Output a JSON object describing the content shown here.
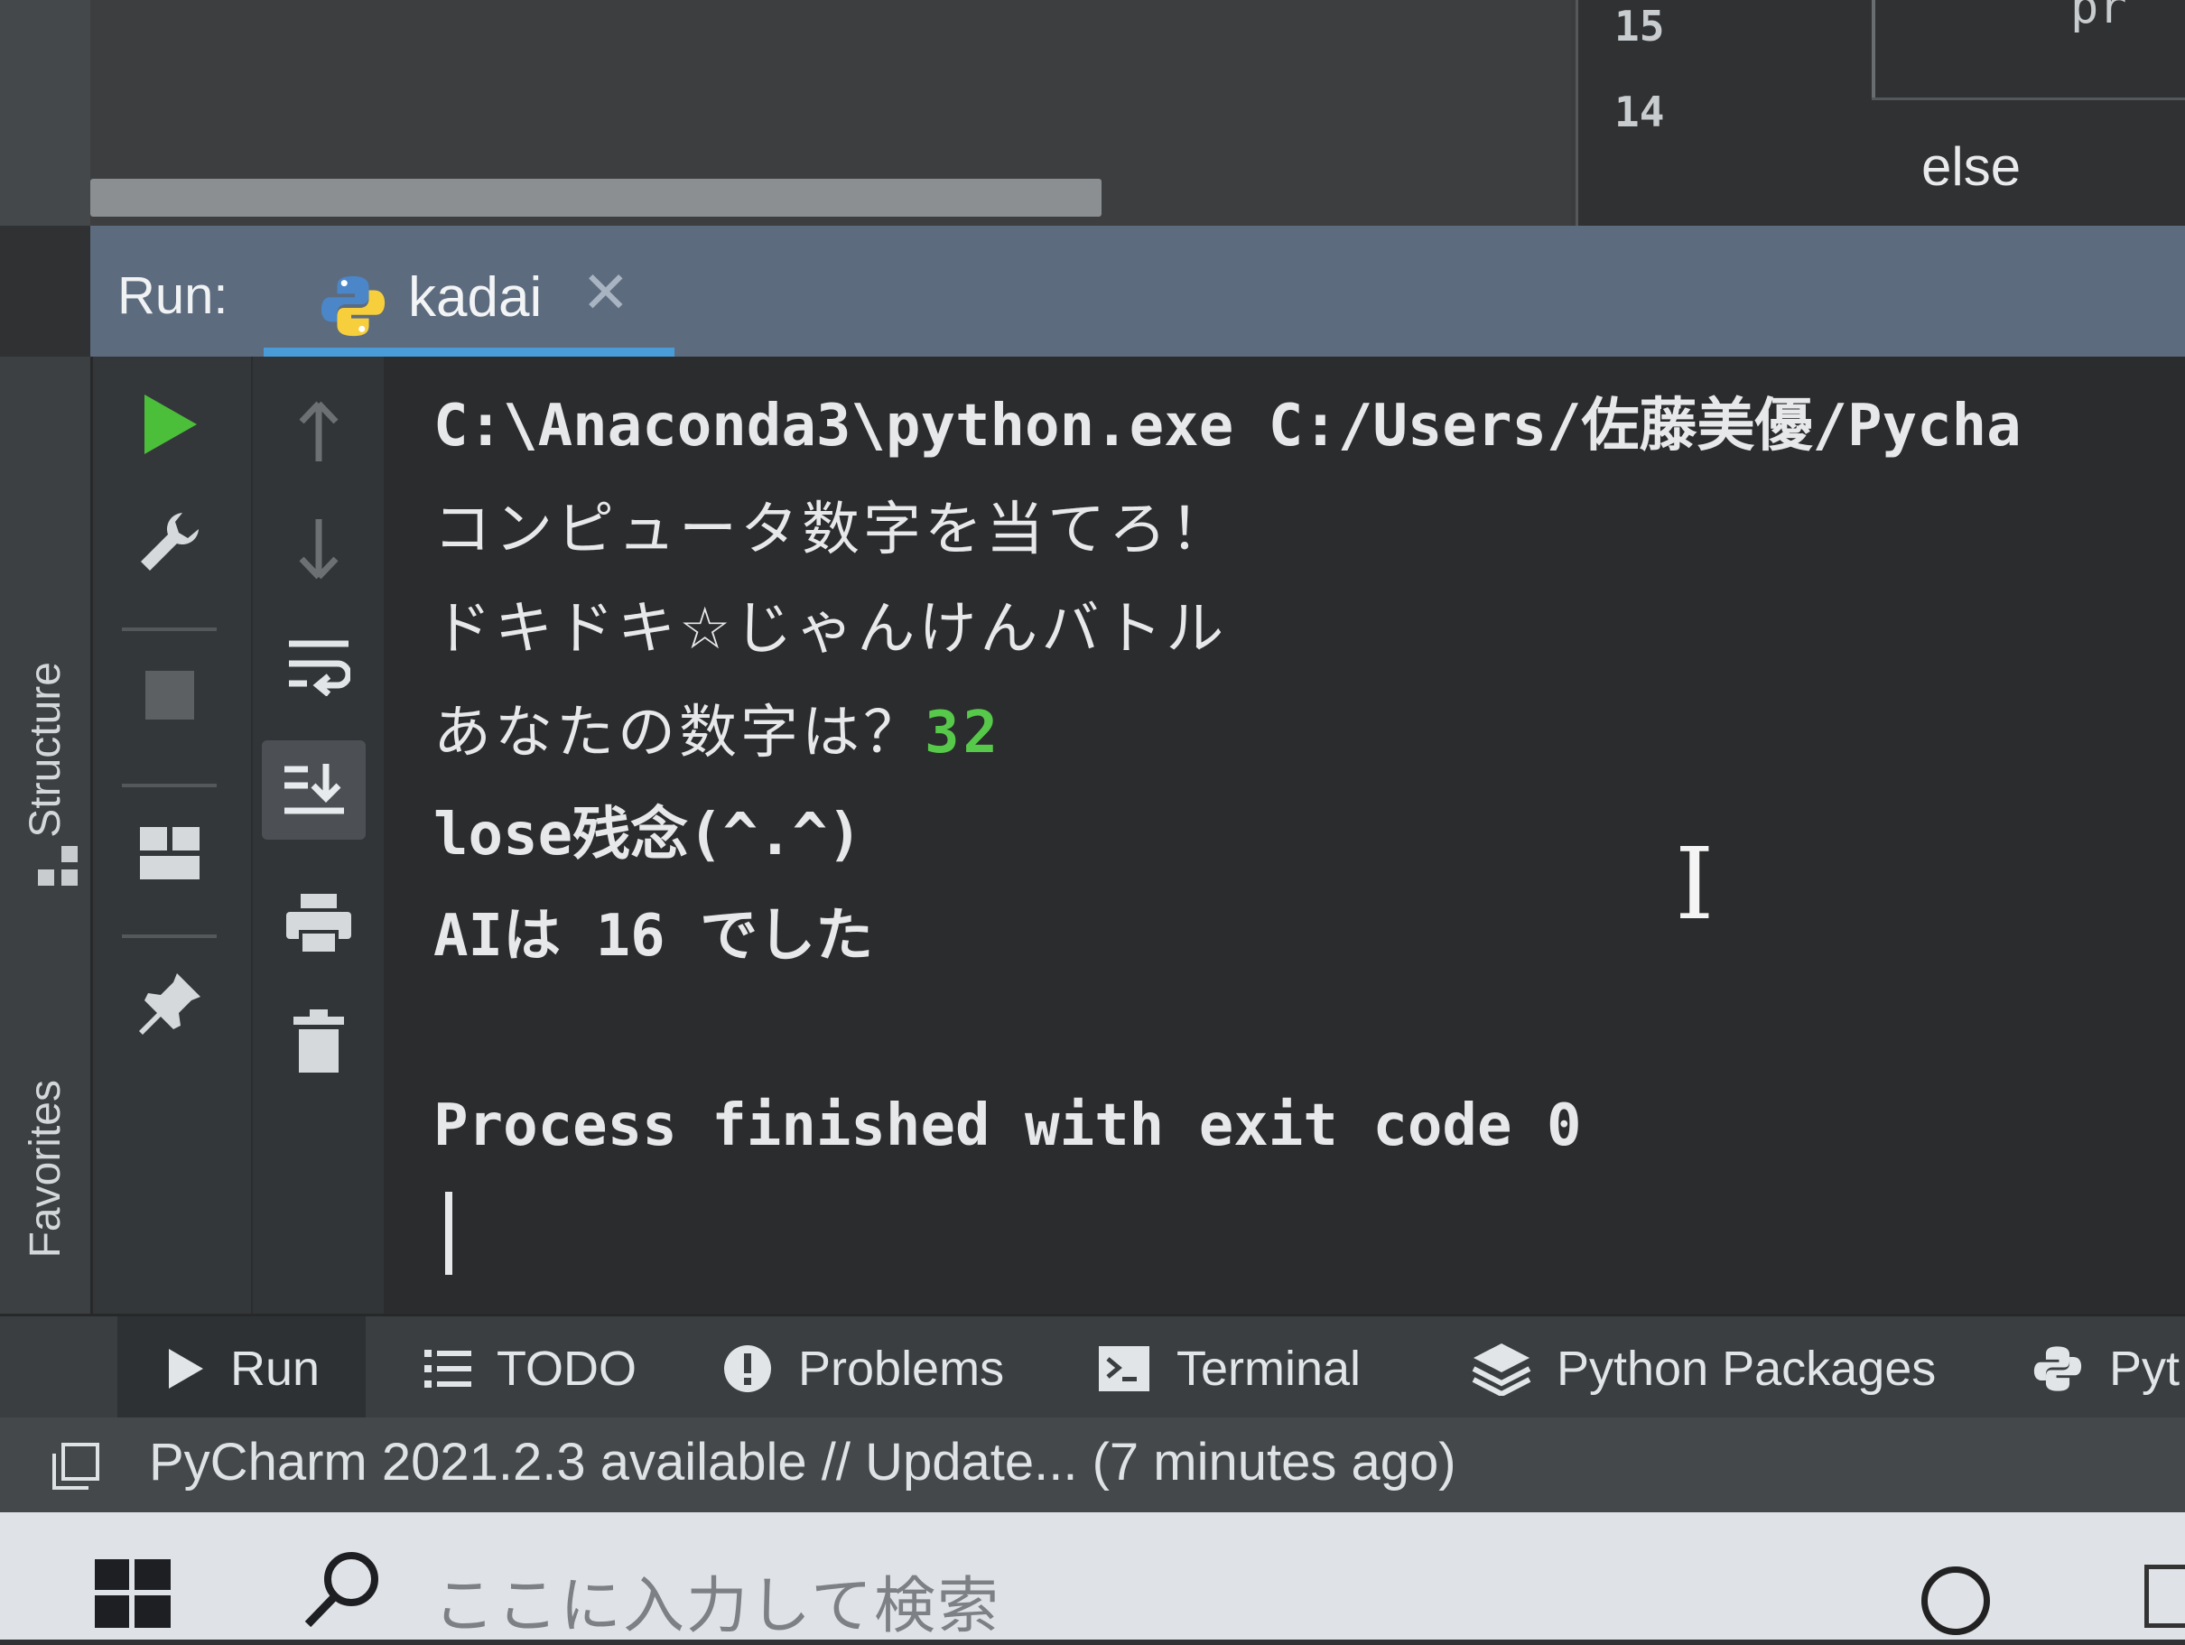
{
  "editor": {
    "line_numbers": [
      "15",
      "14"
    ],
    "right_keyword": "pr",
    "else_keyword": "else"
  },
  "run_panel": {
    "label": "Run:",
    "tab": {
      "name": "kadai",
      "close_glyph": "✕"
    }
  },
  "side_tabs": [
    "Structure",
    "Favorites"
  ],
  "toolbar_left": [
    "run-again",
    "settings-wrench",
    "stop",
    "layout",
    "pin"
  ],
  "toolbar_right": [
    "up-arrow",
    "down-arrow",
    "soft-wrap",
    "scroll-to-end",
    "print",
    "trash"
  ],
  "console": {
    "command": "C:\\Anaconda3\\python.exe C:/Users/佐藤美優/Pycha",
    "line1": "コンピュータ数字を当てろ！",
    "line2": "ドキドキ☆じゃんけんバトル",
    "line3_prompt": "あなたの数字は？",
    "line3_input": "32",
    "line4": "lose残念(^.^)",
    "line5": "AIは 16 でした",
    "exit_message": "Process finished with exit code 0",
    "input_color": "#57c94a"
  },
  "tool_windows": [
    {
      "label": "Run",
      "icon": "play-icon"
    },
    {
      "label": "TODO",
      "icon": "list-icon"
    },
    {
      "label": "Problems",
      "icon": "alert-icon"
    },
    {
      "label": "Terminal",
      "icon": "terminal-icon"
    },
    {
      "label": "Python Packages",
      "icon": "layers-icon"
    },
    {
      "label": "Pyt",
      "icon": "python-icon"
    }
  ],
  "status_bar": {
    "message": "PyCharm 2021.2.3 available // Update... (7 minutes ago)"
  },
  "taskbar": {
    "search_placeholder": "ここに入力して検索"
  },
  "colors": {
    "run_header": "#5c6b7e",
    "tab_underline": "#4a9cd9",
    "run_green": "#4cbf3a",
    "console_bg": "#2b2c2d"
  }
}
